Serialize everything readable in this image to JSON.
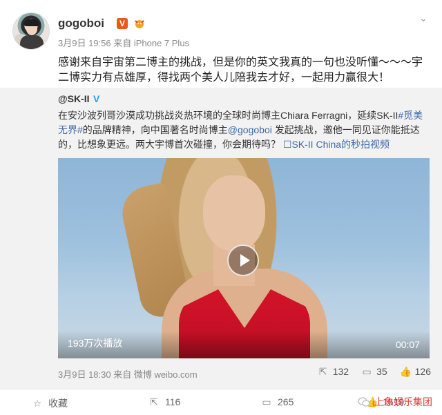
{
  "post": {
    "username": "gogoboi",
    "verified_mark": "V",
    "meta": "3月9日 19:56 来自 iPhone 7 Plus",
    "text": "感谢来自宇宙第二博主的挑战，但是你的英文我真的一句也没听懂～～～宇二博实力有点雄厚，得找两个美人儿陪我去才好，一起用力赢很大！"
  },
  "repost": {
    "author": "@SK-II",
    "author_verified": "V",
    "text_1": "在安沙波列哥沙漠成功挑战炎热环境的全球时尚博主Chiara Ferragni，延续SK-II",
    "hashtag": "#觅美无界#",
    "text_2": "的品牌精神，向中国著名时尚博主",
    "mention": "@gogoboi",
    "text_3": " 发起挑战，邀他一同见证你能抵达的，比想象更远。两大宇博首次碰撞，你会期待吗？",
    "video_link": "SK-II China的秒拍视频",
    "video": {
      "play_count": "193万次播放",
      "duration": "00:07"
    },
    "footer_meta": "3月9日 18:30 来自 微博 weibo.com",
    "actions": {
      "reposts": "132",
      "comments": "35",
      "likes": "126"
    }
  },
  "bottom": {
    "favorite_label": "收藏",
    "reposts": "116",
    "comments": "265",
    "likes": "1619",
    "watermark": "上象娱乐集团"
  },
  "colors": {
    "link": "#3b6aa8",
    "verified_orange": "#e8591a",
    "watermark_red": "#e23838"
  },
  "icons": [
    "chevron-down-icon",
    "vip-icon",
    "play-icon",
    "repost-icon",
    "comment-icon",
    "like-icon",
    "star-icon",
    "wechat-icon"
  ]
}
